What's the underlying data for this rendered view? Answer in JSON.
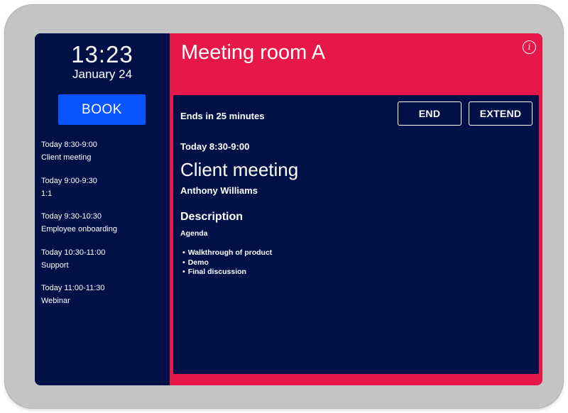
{
  "sidebar": {
    "time": "13:23",
    "date": "January 24",
    "book_label": "BOOK",
    "schedule": [
      {
        "time": "Today 8:30-9:00",
        "title": "Client meeting"
      },
      {
        "time": "Today 9:00-9:30",
        "title": "1:1"
      },
      {
        "time": "Today 9:30-10:30",
        "title": "Employee onboarding"
      },
      {
        "time": "Today 10:30-11:00",
        "title": "Support"
      },
      {
        "time": "Today 11:00-11:30",
        "title": "Webinar"
      }
    ]
  },
  "header": {
    "room_name": "Meeting room A",
    "info_icon": "info-icon",
    "info_glyph": "i"
  },
  "current": {
    "ends_in": "Ends in 25 minutes",
    "end_label": "END",
    "extend_label": "EXTEND",
    "time": "Today 8:30-9:00",
    "title": "Client meeting",
    "organizer": "Anthony Williams",
    "description_heading": "Description",
    "description_intro": "Agenda",
    "agenda_items": [
      "Walkthrough of product",
      "Demo",
      "Final discussion"
    ]
  },
  "colors": {
    "sidebar_bg": "#001147",
    "header_accent": "#e8174a",
    "book_button": "#0a55ff",
    "device_frame": "#c4c4c4"
  }
}
